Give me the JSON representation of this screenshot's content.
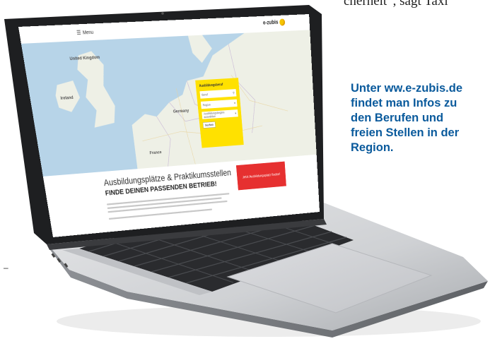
{
  "top_caption": "cherheit“, sagt Taxi",
  "stray_mark": "–",
  "caption": {
    "lines": [
      "Unter ww.e-zubis.de",
      "findet man Infos zu",
      "den Berufen  und",
      "freien Stellen in der",
      "Region."
    ]
  },
  "screen": {
    "menu_label": "Menu",
    "menu_icon": "hamburger-icon",
    "logo_text": "e-zubis",
    "map_labels": {
      "united_kingdom": "United Kingdom",
      "ireland": "Ireland",
      "germany": "Germany",
      "france": "France"
    },
    "search_panel": {
      "title": "Ausbildungsberuf",
      "field_1": "Beruf",
      "field_2": "Region",
      "field_3": "Ausbildungsbeginn auswählen",
      "button": "Suchen"
    },
    "headline_1": "Ausbildungsplätze & Praktikumsstellen",
    "headline_2": "FINDE DEINEN PASSENDEN BETRIEB!",
    "cta_label": "Jetzt Ausbildungsplatz finden!"
  },
  "colors": {
    "caption_blue": "#0a5a9c",
    "search_panel_yellow": "#ffe100",
    "cta_red": "#e63030",
    "map_water": "#b7d4e8",
    "map_land": "#eef0e6"
  }
}
